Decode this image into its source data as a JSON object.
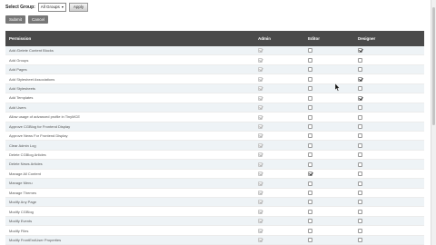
{
  "toolbar": {
    "group_label": "Select Group:",
    "group_value": "All Groups",
    "apply_label": "Apply"
  },
  "actions": {
    "submit_label": "Submit",
    "cancel_label": "Cancel"
  },
  "table": {
    "columns": [
      "Permission",
      "Admin",
      "Editor",
      "Designer"
    ],
    "rows": [
      {
        "label": "Add /Delete Content Blocks",
        "admin": true,
        "editor": false,
        "designer": true
      },
      {
        "label": "Add Groups",
        "admin": true,
        "editor": false,
        "designer": false
      },
      {
        "label": "Add Pages",
        "admin": true,
        "editor": false,
        "designer": false
      },
      {
        "label": "Add Stylesheet Associations",
        "admin": true,
        "editor": false,
        "designer": true
      },
      {
        "label": "Add Stylesheets",
        "admin": true,
        "editor": false,
        "designer": false
      },
      {
        "label": "Add Templates",
        "admin": true,
        "editor": false,
        "designer": true
      },
      {
        "label": "Add Users",
        "admin": true,
        "editor": false,
        "designer": false
      },
      {
        "label": "Allow usage of advanced profile in TinyMCE",
        "admin": true,
        "editor": false,
        "designer": false
      },
      {
        "label": "Approve CGBlog for Frontend Display",
        "admin": true,
        "editor": false,
        "designer": false
      },
      {
        "label": "Approve News For Frontend Display",
        "admin": true,
        "editor": false,
        "designer": false
      },
      {
        "label": "Clear Admin Log",
        "admin": true,
        "editor": false,
        "designer": false
      },
      {
        "label": "Delete CGBlog Articles",
        "admin": true,
        "editor": false,
        "designer": false
      },
      {
        "label": "Delete News Articles",
        "admin": true,
        "editor": false,
        "designer": false
      },
      {
        "label": "Manage All Content",
        "admin": true,
        "editor": true,
        "designer": false
      },
      {
        "label": "Manage Menu",
        "admin": true,
        "editor": false,
        "designer": false
      },
      {
        "label": "Manage Themes",
        "admin": true,
        "editor": false,
        "designer": false
      },
      {
        "label": "Modify Any Page",
        "admin": true,
        "editor": false,
        "designer": false
      },
      {
        "label": "Modify CGBlog",
        "admin": true,
        "editor": false,
        "designer": false
      },
      {
        "label": "Modify Events",
        "admin": true,
        "editor": false,
        "designer": false
      },
      {
        "label": "Modify Files",
        "admin": true,
        "editor": false,
        "designer": false
      },
      {
        "label": "Modify FrontEndUser Properties",
        "admin": true,
        "editor": false,
        "designer": false
      }
    ]
  }
}
